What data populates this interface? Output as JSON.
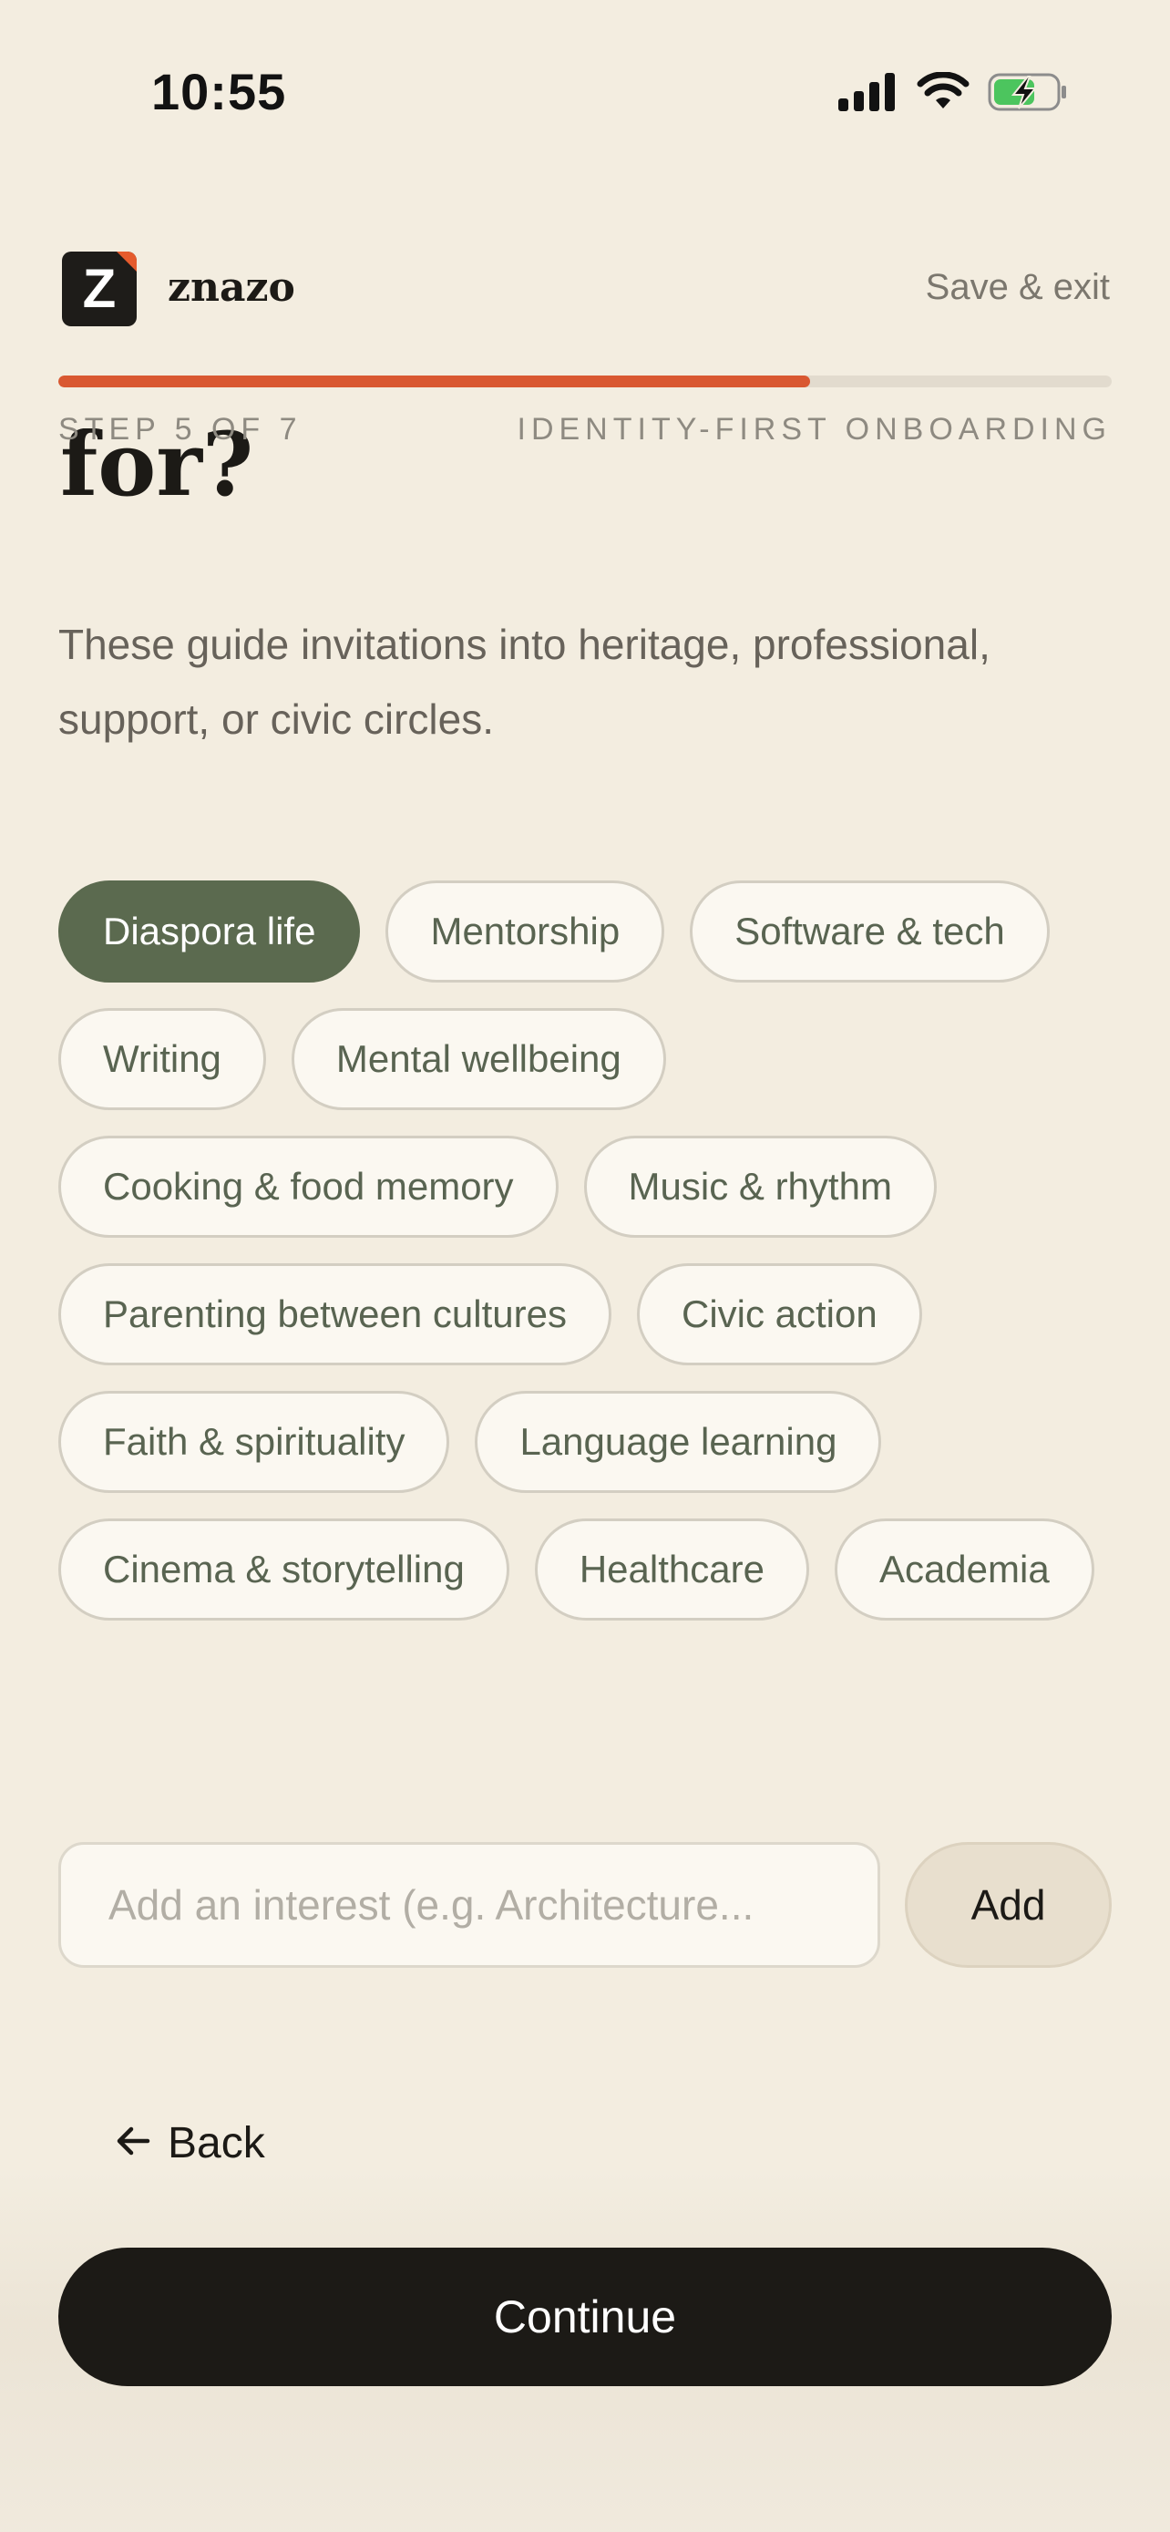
{
  "status_bar": {
    "time": "10:55",
    "icons": [
      "signal-icon",
      "wifi-icon",
      "battery-charging-icon"
    ]
  },
  "header": {
    "logo_letter": "Z",
    "brand_name": "znazo",
    "save_exit_label": "Save & exit"
  },
  "progress": {
    "fraction": 0.714,
    "step_label": "STEP 5 OF 7",
    "flow_label": "IDENTITY-FIRST ONBOARDING"
  },
  "heading_visible_fragment": "for?",
  "description": "These guide invitations into heritage, professional, support, or civic circles.",
  "interests": [
    {
      "label": "Diaspora life",
      "selected": true
    },
    {
      "label": "Mentorship",
      "selected": false
    },
    {
      "label": "Software & tech",
      "selected": false
    },
    {
      "label": "Writing",
      "selected": false
    },
    {
      "label": "Mental wellbeing",
      "selected": false
    },
    {
      "label": "Cooking & food memory",
      "selected": false
    },
    {
      "label": "Music & rhythm",
      "selected": false
    },
    {
      "label": "Parenting between cultures",
      "selected": false
    },
    {
      "label": "Civic action",
      "selected": false
    },
    {
      "label": "Faith & spirituality",
      "selected": false
    },
    {
      "label": "Language learning",
      "selected": false
    },
    {
      "label": "Cinema & storytelling",
      "selected": false
    },
    {
      "label": "Healthcare",
      "selected": false
    },
    {
      "label": "Academia",
      "selected": false
    }
  ],
  "add_interest": {
    "placeholder": "Add an interest (e.g. Architecture...",
    "value": "",
    "button_label": "Add"
  },
  "footer": {
    "back_label": "Back",
    "continue_label": "Continue"
  },
  "colors": {
    "background": "#F3EDE0",
    "accent_progress": "#D95831",
    "selected_chip": "#5B6A4F",
    "primary_button": "#1C1A16"
  }
}
